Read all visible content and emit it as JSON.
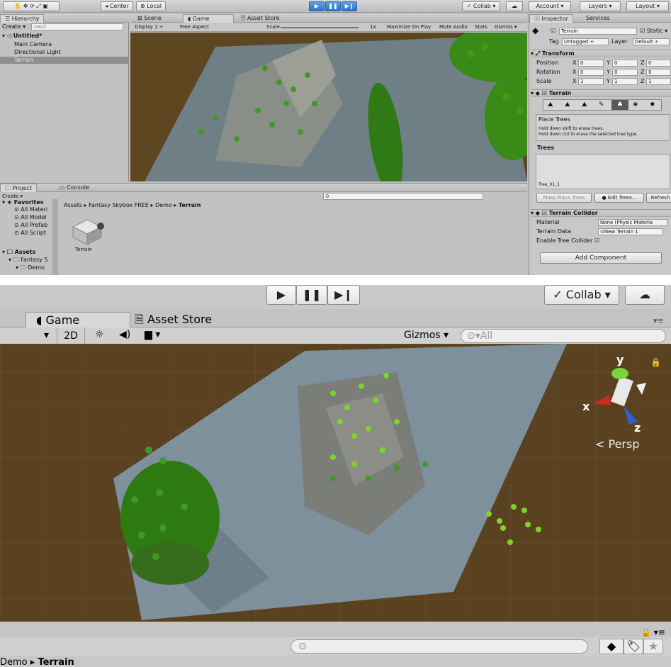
{
  "top": {
    "toolbar": {
      "center_label": "Center",
      "local_label": "Local",
      "collab_label": "Collab",
      "account_label": "Account",
      "layers_label": "Layers",
      "layout_label": "Layout"
    },
    "hierarchy": {
      "tab": "Hierarchy",
      "create": "Create",
      "search_placeholder": "All",
      "scene": "Untitled*",
      "items": [
        "Main Camera",
        "Directional Light",
        "Terrain"
      ]
    },
    "tabs": {
      "scene": "Scene",
      "game": "Game",
      "asset_store": "Asset Store"
    },
    "game_toolbar": {
      "display": "Display 1",
      "aspect": "Free Aspect",
      "scale_label": "Scale",
      "scale_value": "1x",
      "maximize": "Maximize On Play",
      "mute": "Mute Audio",
      "stats": "Stats",
      "gizmos": "Gizmos"
    },
    "inspector": {
      "tab": "Inspector",
      "services_tab": "Services",
      "object_name": "Terrain",
      "static_label": "Static",
      "tag_label": "Tag",
      "tag_value": "Untagged",
      "layer_label": "Layer",
      "layer_value": "Default",
      "transform_title": "Transform",
      "position_label": "Position",
      "rotation_label": "Rotation",
      "scale_label": "Scale",
      "position": {
        "x": "0",
        "y": "0",
        "z": "0"
      },
      "rotation": {
        "x": "0",
        "y": "0",
        "z": "0"
      },
      "scale": {
        "x": "1",
        "y": "1",
        "z": "1"
      },
      "terrain_title": "Terrain",
      "place_trees": "Place Trees",
      "hint_1": "Hold down shift to erase trees.",
      "hint_2": "Hold down ctrl to erase the selected tree type.",
      "trees_title": "Trees",
      "tree_item": "Tree_01_1",
      "mass_place": "Mass Place Trees",
      "edit_trees": "Edit Trees...",
      "refresh": "Refresh",
      "collider_title": "Terrain Collider",
      "material_label": "Material",
      "material_value": "None (Physic Materia",
      "terrain_data_label": "Terrain Data",
      "terrain_data_value": "New Terrain 1",
      "enable_tree_collider": "Enable Tree Collider",
      "add_component": "Add Component"
    },
    "project": {
      "tab": "Project",
      "console_tab": "Console",
      "create": "Create",
      "favorites": "Favorites",
      "fav_items": [
        "All Materi",
        "All Model",
        "All Prefab",
        "All Script"
      ],
      "assets": "Assets",
      "asset_items": [
        "Fantasy S",
        "Demo"
      ],
      "breadcrumb": [
        "Assets",
        "Fantasy Skybox FREE",
        "Demo",
        "Terrain"
      ],
      "asset_name": "Terrain"
    }
  },
  "bottom": {
    "collab_label": "Collab",
    "game_tab": "Game",
    "asset_store_tab": "Asset Store",
    "mode_2d": "2D",
    "gizmos": "Gizmos",
    "search_placeholder": "All",
    "persp": "Persp",
    "axis_x": "x",
    "axis_y": "y",
    "axis_z": "z",
    "breadcrumb_prev": "Demo",
    "breadcrumb_current": "Terrain"
  }
}
